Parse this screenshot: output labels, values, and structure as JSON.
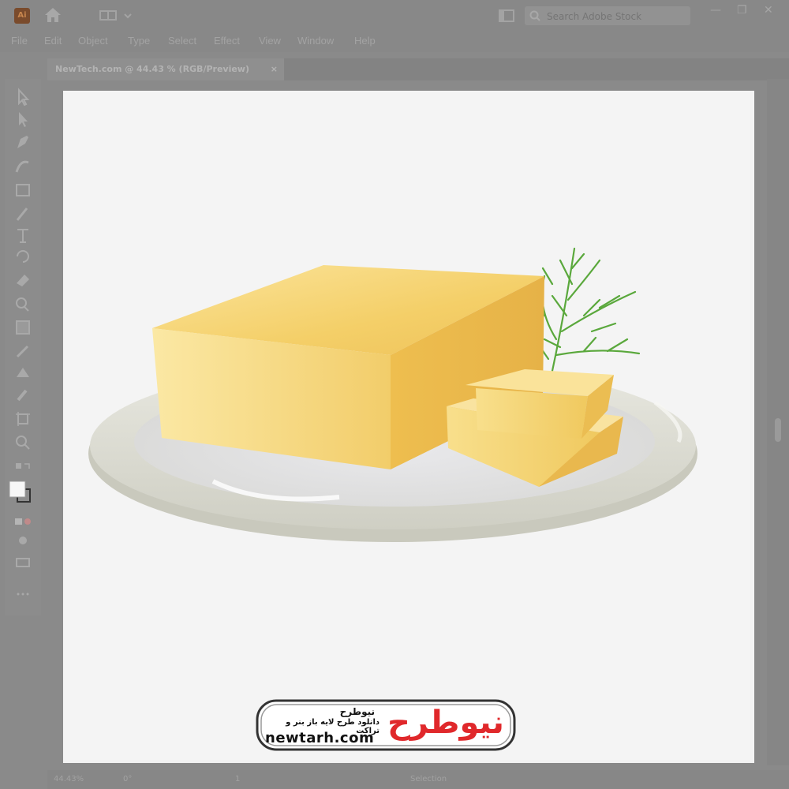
{
  "app": {
    "logo_text": "Ai",
    "search_placeholder": "Search Adobe Stock",
    "window_controls": [
      "—",
      "❐",
      "✕"
    ]
  },
  "menu": [
    "File",
    "Edit",
    "Object",
    "Type",
    "Select",
    "Effect",
    "View",
    "Window",
    "Help"
  ],
  "document_tab": {
    "title": "NewTech.com @ 44.43 % (RGB/Preview)",
    "close": "×"
  },
  "tools": [
    "selection-tool",
    "direct-selection-tool",
    "pen-tool",
    "curvature-tool",
    "rectangle-tool",
    "paintbrush-tool",
    "type-tool",
    "rotate-tool",
    "eraser-tool",
    "shape-builder-tool",
    "gradient-tool",
    "eyedropper-tool",
    "blend-tool",
    "symbol-sprayer-tool",
    "artboard-tool",
    "zoom-tool",
    "swap-colors",
    "fill-stroke",
    "draw-mode",
    "screen-mode",
    "more-tools"
  ],
  "status": {
    "zoom": "44.43%",
    "rotation": "0°",
    "artboard": "1",
    "tool": "Selection"
  },
  "watermark": {
    "brand_fa": "نیوطرح",
    "tagline_fa": "دانلود طرح لایه باز بنر و تراکت",
    "url": "newtarh.com",
    "logo_fa": "نیوطرح"
  },
  "colors": {
    "butter_light": "#fbe9a6",
    "butter_mid": "#f3d06a",
    "butter_dark": "#e7b548",
    "plate": "#dcdcd2",
    "dill": "#6ab54a",
    "logo_red": "#e0282b"
  }
}
